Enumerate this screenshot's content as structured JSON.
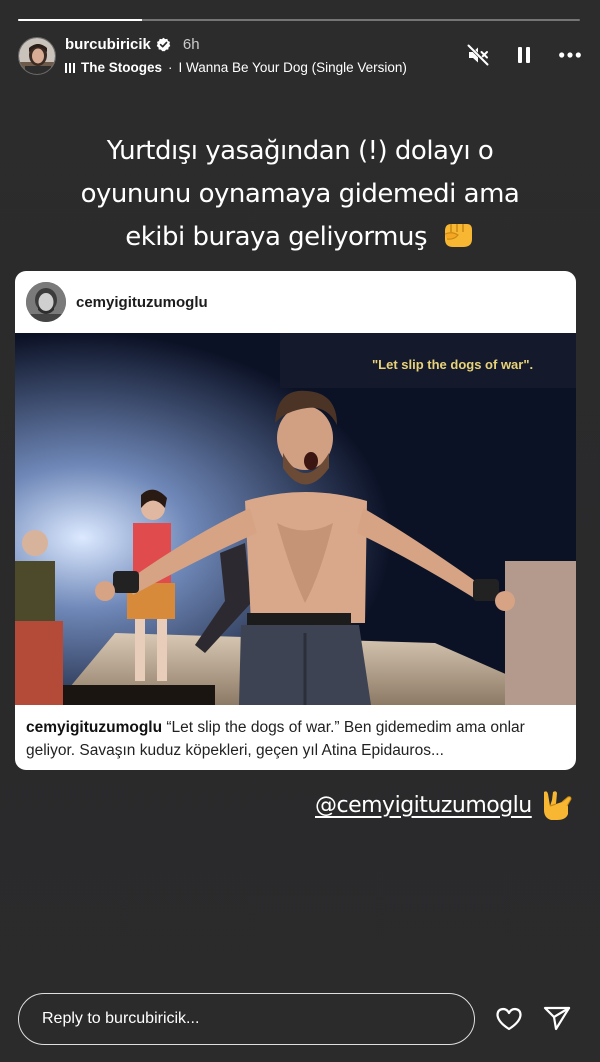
{
  "story": {
    "progress": 0.22
  },
  "header": {
    "username": "burcubiricik",
    "time": "6h",
    "music_artist": "The Stooges",
    "music_separator": "·",
    "music_title": "I Wanna Be Your Dog (Single Version)"
  },
  "caption": {
    "line1": "Yurtdışı yasağından (!) dolayı o",
    "line2": "oyununu oynamaya  gidemedi ama",
    "line3": "ekibi buraya geliyormuş",
    "emoji": "👊"
  },
  "post": {
    "username": "cemyigituzumoglu",
    "photo_text": "\"Let slip the dogs of war\".",
    "caption_user": "cemyigituzumoglu",
    "caption_text": "“Let slip the dogs of war.” Ben gidemedim ama onlar geliyor. Savaşın kuduz köpekleri, geçen yıl Atina Epidauros..."
  },
  "mention": {
    "text": "@cemyigituzumoglu",
    "emoji": "🤟"
  },
  "reply": {
    "placeholder": "Reply to burcubiricik..."
  },
  "colors": {
    "background": "#2a2a2b",
    "verified": "#ffffff",
    "card": "#ffffff"
  },
  "icons": [
    "verified-badge-icon",
    "music-bars-icon",
    "mute-icon",
    "pause-icon",
    "more-icon",
    "heart-icon",
    "send-icon",
    "fist-emoji",
    "rock-hand-emoji"
  ]
}
